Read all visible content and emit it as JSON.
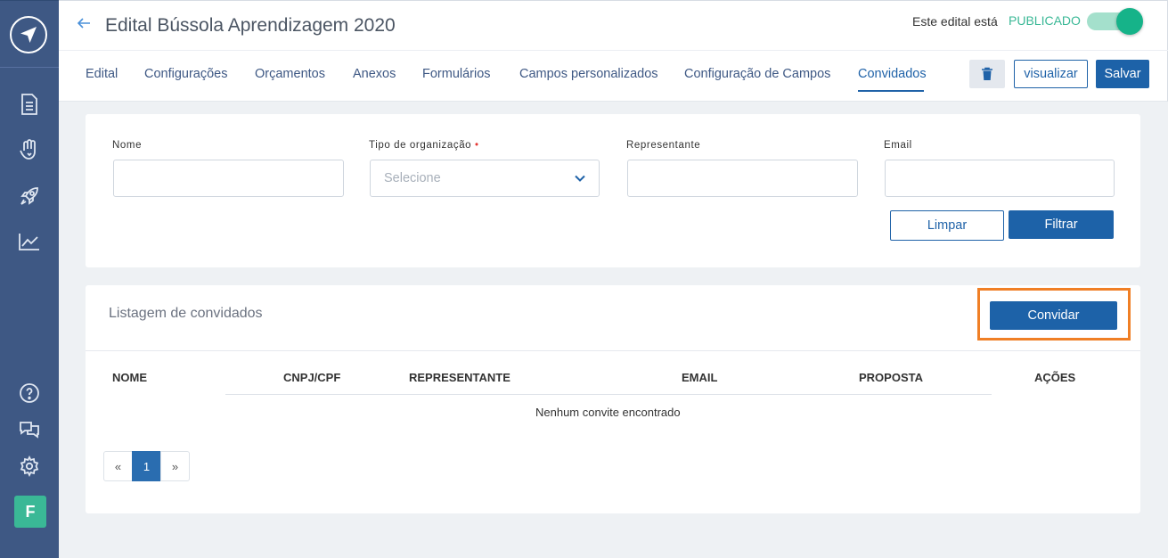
{
  "header": {
    "title": "Edital Bússola Aprendizagem 2020",
    "status_label": "Este edital está",
    "status_value": "PUBLICADO"
  },
  "tabs": [
    {
      "label": "Edital"
    },
    {
      "label": "Configurações"
    },
    {
      "label": "Orçamentos"
    },
    {
      "label": "Anexos"
    },
    {
      "label": "Formulários"
    },
    {
      "label": "Campos personalizados"
    },
    {
      "label": "Configuração de Campos"
    },
    {
      "label": "Convidados"
    }
  ],
  "toolbar": {
    "view_label": "visualizar",
    "save_label": "Salvar"
  },
  "filters": {
    "nome_label": "Nome",
    "nome_value": "",
    "tipo_label": "Tipo de organização",
    "tipo_required": "•",
    "tipo_placeholder": "Selecione",
    "representante_label": "Representante",
    "representante_value": "",
    "email_label": "Email",
    "email_value": "",
    "clear_label": "Limpar",
    "filter_label": "Filtrar"
  },
  "list": {
    "title": "Listagem de convidados",
    "invite_label": "Convidar",
    "columns": [
      "NOME",
      "CNPJ/CPF",
      "REPRESENTANTE",
      "EMAIL",
      "PROPOSTA",
      "AÇÕES"
    ],
    "empty_message": "Nenhum convite encontrado"
  },
  "pagination": {
    "prev": "«",
    "current": "1",
    "next": "»"
  },
  "user": {
    "avatar_initial": "F"
  }
}
